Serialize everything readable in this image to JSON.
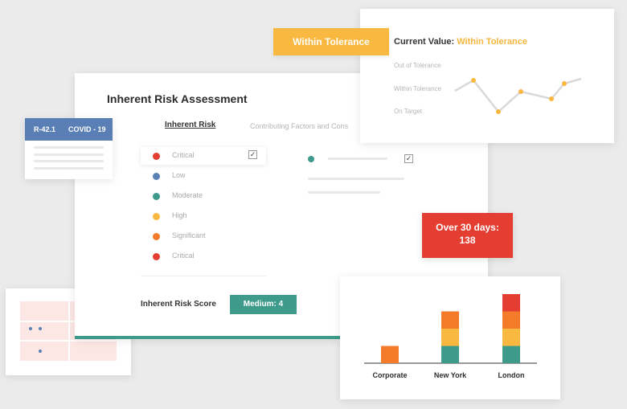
{
  "assessment": {
    "title": "Inherent Risk Assessment",
    "tabs": [
      {
        "label": "Inherent Risk",
        "active": true
      },
      {
        "label": "Contributing Factors and Cons",
        "active": false
      }
    ],
    "risk_levels": [
      {
        "label": "Critical",
        "color": "#e43d32",
        "checked": true
      },
      {
        "label": "Low",
        "color": "#5a7fb5",
        "checked": false
      },
      {
        "label": "Moderate",
        "color": "#3e9b8b",
        "checked": false
      },
      {
        "label": "High",
        "color": "#f9b83f",
        "checked": false
      },
      {
        "label": "Significant",
        "color": "#f47b2a",
        "checked": false
      },
      {
        "label": "Critical",
        "color": "#e43d32",
        "checked": false
      }
    ],
    "factor_check_mark": "✓",
    "check_mark": "✓",
    "score_label": "Inherent Risk Score",
    "score_value": "Medium: 4"
  },
  "tolerance": {
    "badge": "Within Tolerance",
    "title_prefix": "Current Value:",
    "title_value": "Within Tolerance",
    "levels": [
      "Out of Tolerance",
      "Within Tolerance",
      "On Target"
    ],
    "line_color": "#d9d9d9",
    "point_color": "#f9b83f"
  },
  "risk_card": {
    "code": "R-42.1",
    "name": "COVID - 19"
  },
  "overdue": {
    "label": "Over 30 days:",
    "value": "138"
  },
  "chart_data": {
    "type": "bar",
    "stacked": true,
    "categories": [
      "Corporate",
      "New York",
      "London"
    ],
    "series": [
      {
        "color": "#3e9b8b",
        "values": [
          0,
          1,
          1
        ]
      },
      {
        "color": "#f9b83f",
        "values": [
          0,
          1,
          1
        ]
      },
      {
        "color": "#f47b2a",
        "values": [
          1,
          1,
          1
        ]
      },
      {
        "color": "#e43d32",
        "values": [
          0,
          0,
          1
        ]
      }
    ],
    "title": "",
    "xlabel": "",
    "ylabel": ""
  },
  "colors": {
    "accent": "#3e9b8b",
    "warning": "#f9b83f",
    "danger": "#e43d32",
    "info": "#5a7fb5",
    "orange": "#f47b2a"
  }
}
